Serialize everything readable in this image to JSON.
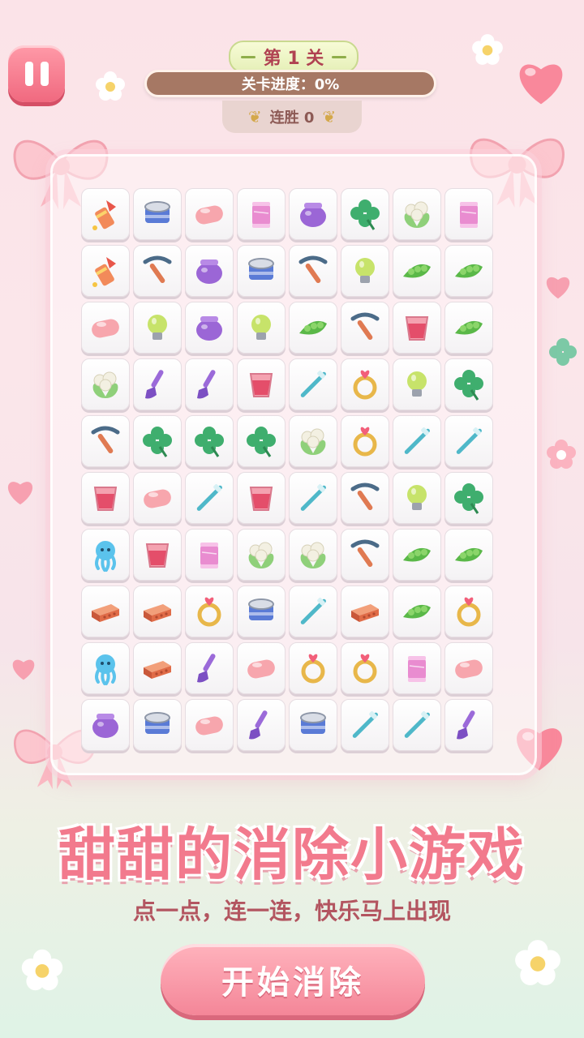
{
  "header": {
    "level_label": "第 1 关",
    "progress_label": "关卡进度：0%",
    "progress_value": 0,
    "streak_label": "连胜 0"
  },
  "board": {
    "rows": [
      [
        "firework",
        "can",
        "soap",
        "thread",
        "pot",
        "clover",
        "cauliflower",
        "thread"
      ],
      [
        "firework",
        "pickaxe",
        "pot",
        "can",
        "pickaxe",
        "bulb",
        "peas",
        "peas"
      ],
      [
        "soap",
        "bulb",
        "pot",
        "bulb",
        "peas",
        "pickaxe",
        "cup",
        "peas"
      ],
      [
        "cauliflower",
        "brush",
        "brush",
        "cup",
        "toothbrush",
        "ring",
        "bulb",
        "clover"
      ],
      [
        "pickaxe",
        "clover",
        "clover",
        "clover",
        "cauliflower",
        "ring",
        "toothbrush",
        "toothbrush"
      ],
      [
        "cup",
        "soap",
        "toothbrush",
        "cup",
        "toothbrush",
        "pickaxe",
        "bulb",
        "clover"
      ],
      [
        "octopus",
        "cup",
        "thread",
        "cauliflower",
        "cauliflower",
        "pickaxe",
        "peas",
        "peas"
      ],
      [
        "brick",
        "brick",
        "ring",
        "can",
        "toothbrush",
        "brick",
        "peas",
        "ring"
      ],
      [
        "octopus",
        "brick",
        "brush",
        "soap",
        "ring",
        "ring",
        "thread",
        "soap"
      ],
      [
        "pot",
        "can",
        "soap",
        "brush",
        "can",
        "toothbrush",
        "toothbrush",
        "brush"
      ]
    ]
  },
  "title": "甜甜的消除小游戏",
  "subtitle": "点一点，连一连，快乐马上出现",
  "start_button": "开始消除"
}
